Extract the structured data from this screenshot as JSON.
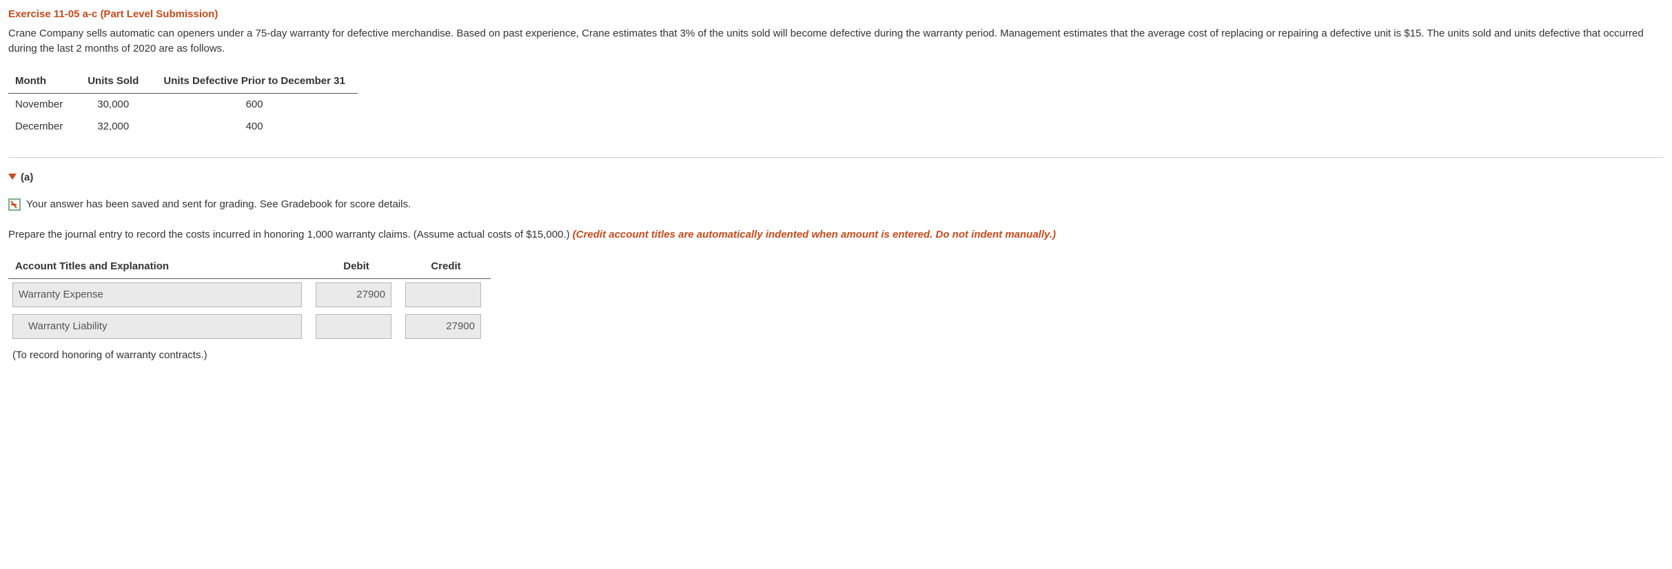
{
  "exercise": {
    "title": "Exercise 11-05 a-c (Part Level Submission)",
    "problem_text": "Crane Company sells automatic can openers under a 75-day warranty for defective merchandise. Based on past experience, Crane estimates that 3% of the units sold will become defective during the warranty period. Management estimates that the average cost of replacing or repairing a defective unit is $15. The units sold and units defective that occurred during the last 2 months of 2020 are as follows."
  },
  "data_table": {
    "headers": {
      "month": "Month",
      "units_sold": "Units Sold",
      "units_defective": "Units Defective Prior to December 31"
    },
    "rows": [
      {
        "month": "November",
        "units_sold": "30,000",
        "units_defective": "600"
      },
      {
        "month": "December",
        "units_sold": "32,000",
        "units_defective": "400"
      }
    ]
  },
  "part": {
    "label": "(a)"
  },
  "status": {
    "message": "Your answer has been saved and sent for grading. See Gradebook for score details."
  },
  "instruction": {
    "text": "Prepare the journal entry to record the costs incurred in honoring 1,000 warranty claims. (Assume actual costs of $15,000.) ",
    "hint": "(Credit account titles are automatically indented when amount is entered. Do not indent manually.)"
  },
  "journal": {
    "headers": {
      "account": "Account Titles and Explanation",
      "debit": "Debit",
      "credit": "Credit"
    },
    "rows": [
      {
        "account": "Warranty Expense",
        "debit": "27900",
        "credit": ""
      },
      {
        "account": "Warranty Liability",
        "debit": "",
        "credit": "27900"
      }
    ],
    "caption": "(To record honoring of warranty contracts.)"
  }
}
